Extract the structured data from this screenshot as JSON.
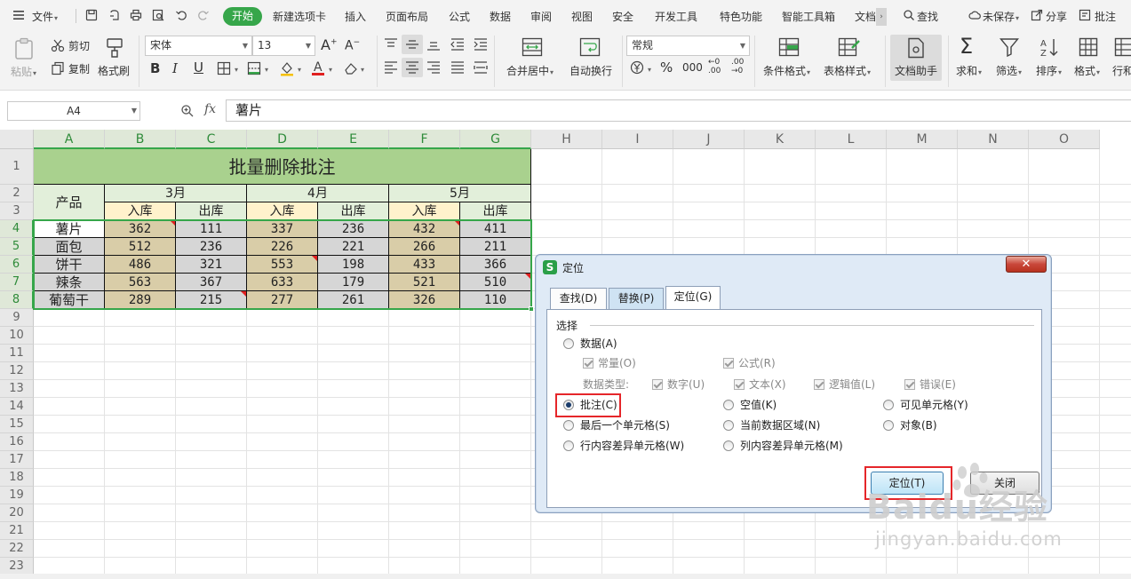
{
  "menubar": {
    "file": "文件",
    "tabs": [
      "开始",
      "新建选项卡",
      "插入",
      "页面布局",
      "公式",
      "数据",
      "审阅",
      "视图",
      "安全",
      "开发工具",
      "特色功能",
      "智能工具箱",
      "文档"
    ],
    "search": "查找",
    "unsaved": "未保存",
    "share": "分享",
    "comment": "批注"
  },
  "ribbon": {
    "paste": "粘贴",
    "cut": "剪切",
    "copy": "复制",
    "format_painter": "格式刷",
    "font_name": "宋体",
    "font_size": "13",
    "merge_center": "合并居中",
    "wrap_text": "自动换行",
    "number_format": "常规",
    "cond_format": "条件格式",
    "table_style": "表格样式",
    "doc_assistant": "文档助手",
    "sum": "求和",
    "filter": "筛选",
    "sort": "排序",
    "format": "格式",
    "row_col": "行和"
  },
  "formula": {
    "namebox": "A4",
    "fx": "fx",
    "content": "薯片"
  },
  "sheet": {
    "columns": [
      "A",
      "B",
      "C",
      "D",
      "E",
      "F",
      "G",
      "H",
      "I",
      "J",
      "K",
      "L",
      "M",
      "N",
      "O"
    ],
    "rows": [
      "1",
      "2",
      "3",
      "4",
      "5",
      "6",
      "7",
      "8",
      "9",
      "10",
      "11",
      "12",
      "13",
      "14",
      "15",
      "16",
      "17",
      "18",
      "19",
      "20",
      "21",
      "22",
      "23"
    ],
    "title": "批量删除批注",
    "product_header": "产品",
    "months": [
      "3月",
      "4月",
      "5月"
    ],
    "in_label": "入库",
    "out_label": "出库",
    "products": [
      "薯片",
      "面包",
      "饼干",
      "辣条",
      "葡萄干"
    ],
    "values": [
      [
        "362",
        "111",
        "337",
        "236",
        "432",
        "411"
      ],
      [
        "512",
        "236",
        "226",
        "221",
        "266",
        "211"
      ],
      [
        "486",
        "321",
        "553",
        "198",
        "433",
        "366"
      ],
      [
        "563",
        "367",
        "633",
        "179",
        "521",
        "510"
      ],
      [
        "289",
        "215",
        "277",
        "261",
        "326",
        "110"
      ]
    ]
  },
  "dialog": {
    "title": "定位",
    "close": "✕",
    "tabs": [
      "查找(D)",
      "替换(P)",
      "定位(G)"
    ],
    "group": "选择",
    "opt_data": "数据(A)",
    "chk_const": "常量(O)",
    "chk_formula": "公式(R)",
    "data_type_label": "数据类型:",
    "chk_number": "数字(U)",
    "chk_text": "文本(X)",
    "chk_logic": "逻辑值(L)",
    "chk_error": "错误(E)",
    "opt_comment": "批注(C)",
    "opt_blank": "空值(K)",
    "opt_visible": "可见单元格(Y)",
    "opt_last_cell": "最后一个单元格(S)",
    "opt_current_region": "当前数据区域(N)",
    "opt_object": "对象(B)",
    "opt_row_diff": "行内容差异单元格(W)",
    "opt_col_diff": "列内容差异单元格(M)",
    "btn_locate": "定位(T)",
    "btn_close": "关闭"
  },
  "watermark": {
    "main": "Baidu经验",
    "sub": "jingyan.baidu.com"
  },
  "colors": {
    "accent_green": "#36a64a",
    "title_fill": "#a9d18e",
    "highlight_red": "#e5262a"
  }
}
